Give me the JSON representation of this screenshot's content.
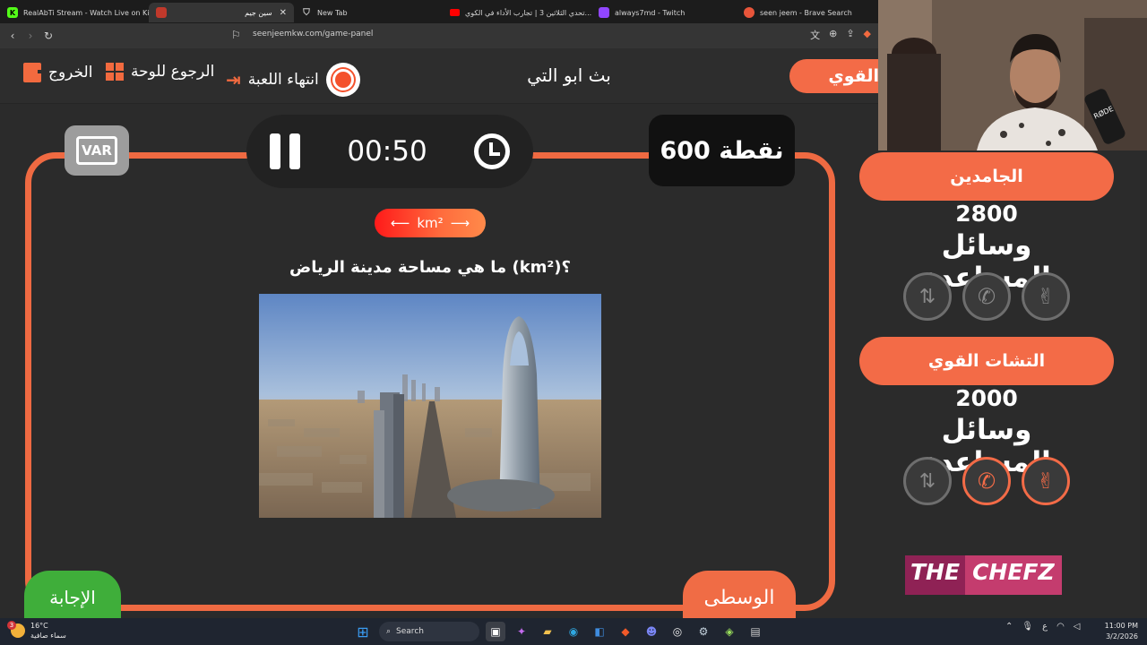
{
  "browser": {
    "tabs": [
      {
        "title": "RealAbTi Stream - Watch Live on Kick",
        "active": false
      },
      {
        "title": "سين جيم",
        "active": true
      },
      {
        "title": "New Tab",
        "active": false
      },
      {
        "title": "تحدي الثلاثين 3 | تجارب الأداء في الكوي...",
        "active": false
      },
      {
        "title": "always7md - Twitch",
        "active": false
      },
      {
        "title": "seen jeem - Brave Search",
        "active": false
      }
    ],
    "url": "seenjeemkw.com/game-panel"
  },
  "header": {
    "exit_label": "الخروج",
    "back_label": "الرجوع للوحة",
    "end_game_label": "انتهاء اللعبة",
    "game_title": "بث ابو التي",
    "current_team": "القوي"
  },
  "game": {
    "var_label": "VAR",
    "timer": "00:50",
    "points": "600 نقطة",
    "unit": "km²",
    "question": "ما هي مساحة مدينة الرياض (km²)؟",
    "answer_label": "الإجابة",
    "level_label": "الوسطى"
  },
  "teams": [
    {
      "name": "الجامدين",
      "score": "2800",
      "aids_title": "وسائل المساعدة",
      "aids": [
        {
          "icon": "peace-icon",
          "used": false
        },
        {
          "icon": "phone-icon",
          "used": false
        },
        {
          "icon": "swap-icon",
          "used": false
        }
      ]
    },
    {
      "name": "التشات القوي",
      "score": "2000",
      "aids_title": "وسائل المساعدة",
      "aids": [
        {
          "icon": "peace-icon",
          "used": true
        },
        {
          "icon": "phone-icon",
          "used": true
        },
        {
          "icon": "swap-icon",
          "used": false
        }
      ]
    }
  ],
  "sponsor": {
    "part1": "THE",
    "part2": "CHEFZ"
  },
  "taskbar": {
    "weather_temp": "16°C",
    "weather_desc": "سماء صافية",
    "notif_count": "3",
    "search_label": "Search",
    "time": "11:00 PM",
    "date": "3/2/2026",
    "lang": "ع"
  },
  "colors": {
    "accent": "#f36b47",
    "green": "#3fae3a",
    "bg": "#2b2b2b"
  }
}
